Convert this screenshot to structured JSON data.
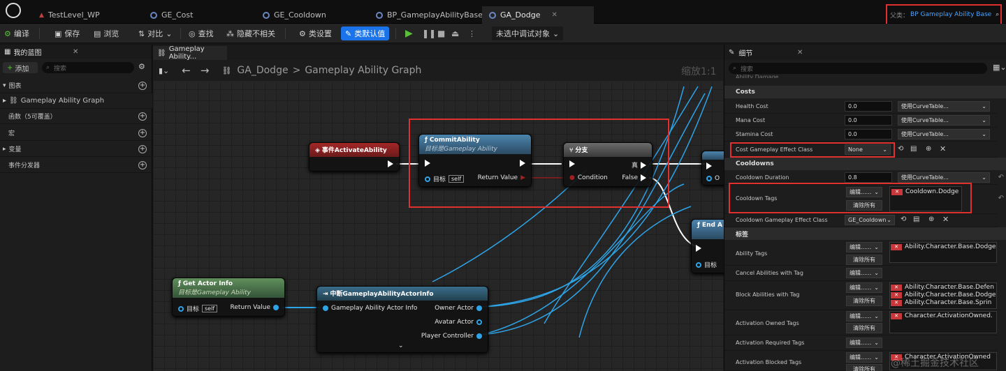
{
  "tabs": {
    "t1": "TestLevel_WP",
    "t2": "GE_Cost",
    "t3": "GE_Cooldown",
    "t4": "BP_GameplayAbilityBase",
    "t5": "GA_Dodge"
  },
  "parent_class": {
    "label": "父类：",
    "value": "BP Gameplay Ability Base"
  },
  "toolbar": {
    "compile": "编译",
    "save": "保存",
    "browse": "浏览",
    "diff": "对比",
    "find": "查找",
    "hide_unrelated": "隐藏不相关",
    "class_settings": "类设置",
    "class_defaults": "类默认值",
    "debug_target": "未选中调试对象"
  },
  "left": {
    "title": "我的蓝图",
    "add": "添加",
    "search_placeholder": "搜索",
    "sections": [
      "图表",
      "Gameplay Ability Graph",
      "函数（5可覆盖）",
      "宏",
      "变量",
      "事件分发器"
    ]
  },
  "graph": {
    "tab": "Gameplay Ability...",
    "breadcrumb_root": "GA_Dodge",
    "breadcrumb_sep": ">",
    "breadcrumb_graph": "Gameplay Ability Graph",
    "zoom": "缩放1:1",
    "nodes": {
      "activate": "事件ActivateAbility",
      "commit": "CommitAbility",
      "commit_sub": "目标是Gameplay Ability",
      "commit_target": "目标",
      "commit_self": "self",
      "commit_return": "Return Value",
      "branch": "分支",
      "branch_condition": "Condition",
      "branch_true": "真",
      "branch_false": "False",
      "end": "End A",
      "end_target": "目标",
      "getactor": "Get Actor Info",
      "getactor_sub": "目标是Gameplay Ability",
      "getactor_target": "目标",
      "getactor_self": "self",
      "getactor_return": "Return Value",
      "break": "中断GameplayAbilityActorInfo",
      "break_in": "Gameplay Ability Actor Info",
      "break_owner": "Owner Actor",
      "break_avatar": "Avatar Actor",
      "break_pc": "Player Controller",
      "partial_o": "O"
    }
  },
  "details": {
    "title": "细节",
    "search_placeholder": "搜索",
    "ability_damage": "Ability Damage",
    "costs": "Costs",
    "health_cost": "Health Cost",
    "mana_cost": "Mana Cost",
    "stamina_cost": "Stamina Cost",
    "zero": "0.0",
    "curve": "使用CurveTable...",
    "cost_ge_class": "Cost Gameplay Effect Class",
    "none": "None",
    "cooldowns": "Cooldowns",
    "cooldown_duration": "Cooldown Duration",
    "cooldown_value": "0.8",
    "cooldown_tags": "Cooldown Tags",
    "edit": "编辑......",
    "clear_all": "清除所有",
    "cooldown_tag_value": "Cooldown.Dodge",
    "cooldown_ge_class": "Cooldown Gameplay Effect Class",
    "cooldown_ge_value": "GE_Cooldown",
    "tags_section": "标签",
    "ability_tags": "Ability Tags",
    "ability_tag_value": "Ability.Character.Base.Dodge",
    "cancel_tags": "Cancel Abilities with Tag",
    "block_tags": "Block Abilities with Tag",
    "block_values": [
      "Ability.Character.Base.Defen",
      "Ability.Character.Base.Dodge",
      "Ability.Character.Base.Sprin"
    ],
    "owned_tags": "Activation Owned Tags",
    "owned_value": "Character.ActivationOwned.",
    "required_tags": "Activation Required Tags",
    "blocked_tags": "Activation Blocked Tags",
    "blocked_value": "Character.ActivationOwned",
    "watermark": "@稀土掘金技术社区"
  },
  "colors": {
    "accent": "#1a73e8",
    "highlight_box": "#e03030",
    "wire_blue": "#2ea4e8",
    "event_red": "#8a1f1f",
    "function_blue": "#3b6e8f",
    "branch_gray": "#555555",
    "getactor_green": "#4f7a4a"
  }
}
